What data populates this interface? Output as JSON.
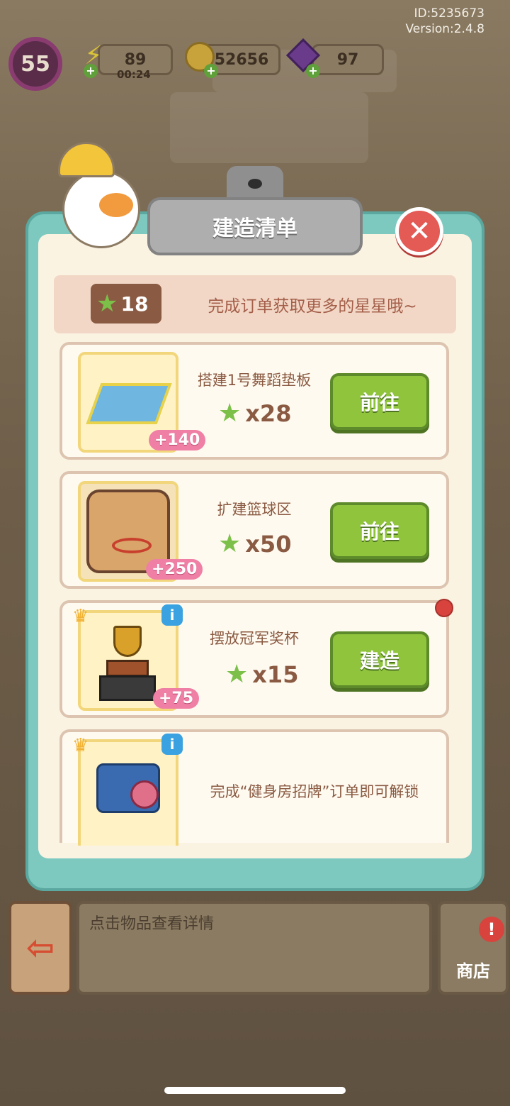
{
  "device": {
    "id": "ID:5235673",
    "version": "Version:2.4.8"
  },
  "hud": {
    "level": "55",
    "energy": "89",
    "energy_timer": "00:24",
    "coins": "52656",
    "gems": "97"
  },
  "panel": {
    "title": "建造清单",
    "close_icon": "close-icon",
    "stars": "18",
    "stars_hint": "完成订单获取更多的星星哦~"
  },
  "tasks": [
    {
      "title": "搭建1号舞蹈垫板",
      "cost": "x28",
      "bonus": "+140",
      "button": "前往",
      "crown": false,
      "info": false
    },
    {
      "title": "扩建篮球区",
      "cost": "x50",
      "bonus": "+250",
      "button": "前往",
      "crown": false,
      "info": false
    },
    {
      "title": "摆放冠军奖杯",
      "cost": "x15",
      "bonus": "+75",
      "button": "建造",
      "crown": true,
      "info": true
    },
    {
      "lock_text": "完成“健身房招牌”订单即可解锁",
      "crown": true,
      "info": true
    }
  ],
  "bottom": {
    "detail_placeholder": "点击物品查看详情",
    "shop_label": "商店",
    "shop_alert": "!"
  },
  "colors": {
    "accent_green": "#8fc43c",
    "panel_teal": "#7dc9c0",
    "star_green": "#7cc04a",
    "bonus_pink": "#ef7fa4"
  }
}
